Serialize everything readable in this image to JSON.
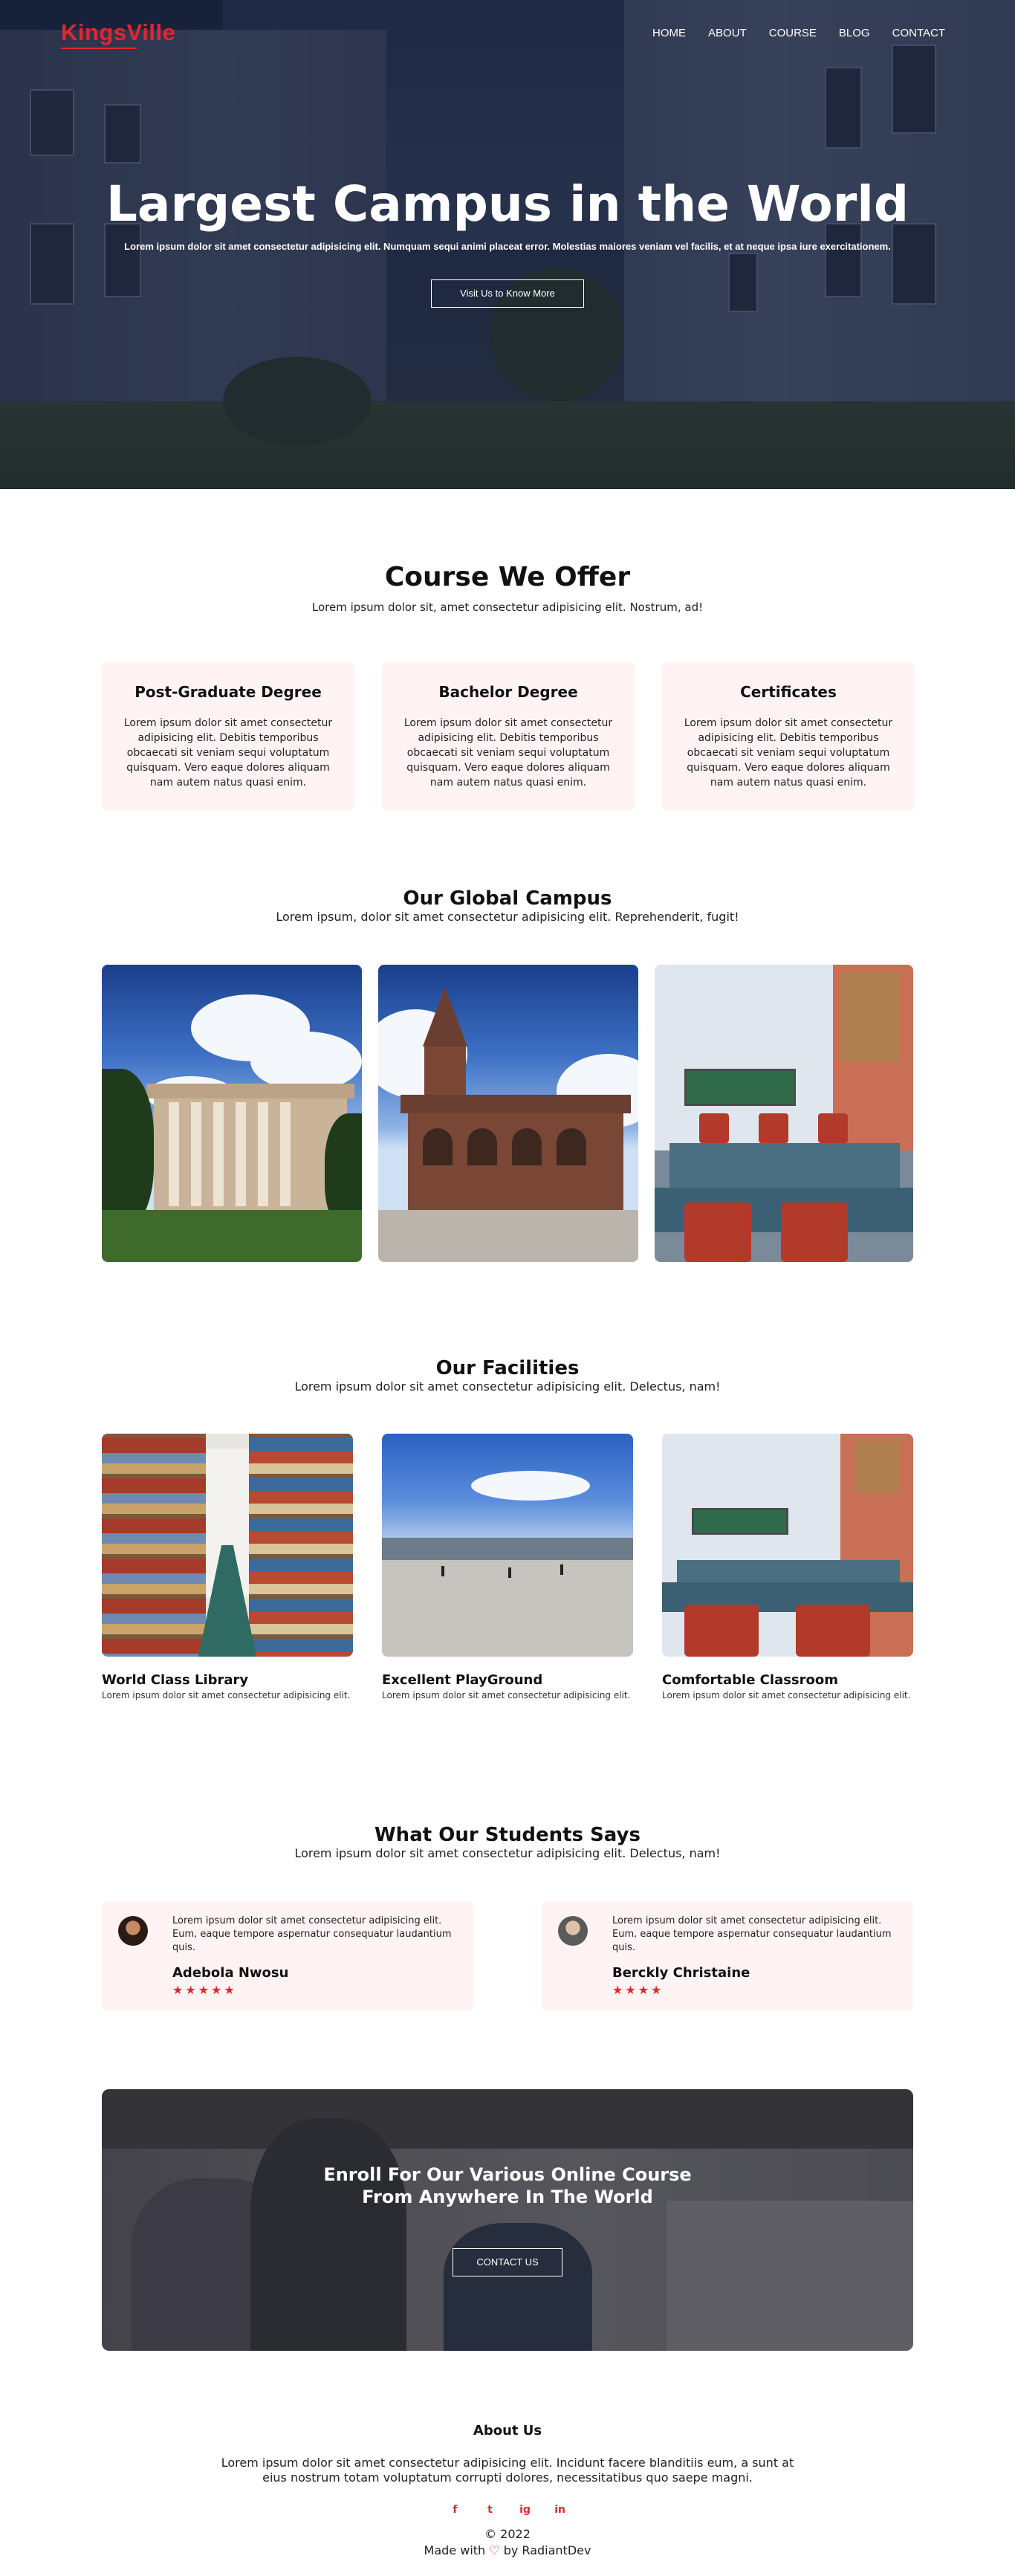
{
  "brand": {
    "name": "KingsVille",
    "accent": "#e3262f",
    "card_bg": "#fff3f3"
  },
  "nav": {
    "items": [
      "HOME",
      "ABOUT",
      "COURSE",
      "BLOG",
      "CONTACT"
    ]
  },
  "hero": {
    "title": "Largest Campus in the World",
    "subtitle": "Lorem ipsum dolor sit amet consectetur adipisicing elit. Numquam sequi animi placeat error. Molestias maiores veniam vel facilis, et at neque ipsa iure exercitationem.",
    "button": "Visit Us to Know More"
  },
  "courses": {
    "title": "Course We Offer",
    "subtitle": "Lorem ipsum dolor sit, amet consectetur adipisicing elit. Nostrum, ad!",
    "cards": [
      {
        "title": "Post-Graduate Degree",
        "text": "Lorem ipsum dolor sit amet consectetur adipisicing elit. Debitis temporibus obcaecati sit veniam sequi voluptatum quisquam. Vero eaque dolores aliquam nam autem natus quasi enim."
      },
      {
        "title": "Bachelor Degree",
        "text": "Lorem ipsum dolor sit amet consectetur adipisicing elit. Debitis temporibus obcaecati sit veniam sequi voluptatum quisquam. Vero eaque dolores aliquam nam autem natus quasi enim."
      },
      {
        "title": "Certificates",
        "text": "Lorem ipsum dolor sit amet consectetur adipisicing elit. Debitis temporibus obcaecati sit veniam sequi voluptatum quisquam. Vero eaque dolores aliquam nam autem natus quasi enim."
      }
    ]
  },
  "campus": {
    "title": "Our Global Campus",
    "subtitle": "Lorem ipsum, dolor sit amet consectetur adipisicing elit. Reprehenderit, fugit!"
  },
  "facilities": {
    "title": "Our Facilities",
    "subtitle": "Lorem ipsum dolor sit amet consectetur adipisicing elit. Delectus, nam!",
    "items": [
      {
        "name": "World Class Library",
        "desc": "Lorem ipsum dolor sit amet consectetur adipisicing elit."
      },
      {
        "name": "Excellent PlayGround",
        "desc": "Lorem ipsum dolor sit amet consectetur adipisicing elit."
      },
      {
        "name": "Comfortable Classroom",
        "desc": "Lorem ipsum dolor sit amet consectetur adipisicing elit."
      }
    ]
  },
  "testimonials": {
    "title": "What Our Students Says",
    "subtitle": "Lorem ipsum dolor sit amet consectetur adipisicing elit. Delectus, nam!",
    "items": [
      {
        "text": "Lorem ipsum dolor sit amet consectetur adipisicing elit. Eum, eaque tempore aspernatur consequatur laudantium quis.",
        "name": "Adebola Nwosu",
        "rating": 5,
        "stars": "★★★★★"
      },
      {
        "text": "Lorem ipsum dolor sit amet consectetur adipisicing elit. Eum, eaque tempore aspernatur consequatur laudantium quis.",
        "name": "Berckly Christaine",
        "rating": 4,
        "stars": "★★★★"
      }
    ]
  },
  "enroll": {
    "line1": "Enroll For Our Various Online Course",
    "line2": "From Anywhere In The World",
    "button": "CONTACT US"
  },
  "footer": {
    "title": "About Us",
    "text": "Lorem ipsum dolor sit amet consectetur adipisicing elit. Incidunt facere blanditiis eum, a sunt at eius nostrum totam voluptatum corrupti dolores, necessitatibus quo saepe magni.",
    "social": [
      "f",
      "t",
      "ig",
      "in"
    ],
    "social_icons": [
      "facebook-icon",
      "twitter-icon",
      "instagram-icon",
      "linkedin-icon"
    ],
    "copyright": "© 2022",
    "made_prefix": "Made with",
    "made_suffix": "by RadiantDev"
  }
}
